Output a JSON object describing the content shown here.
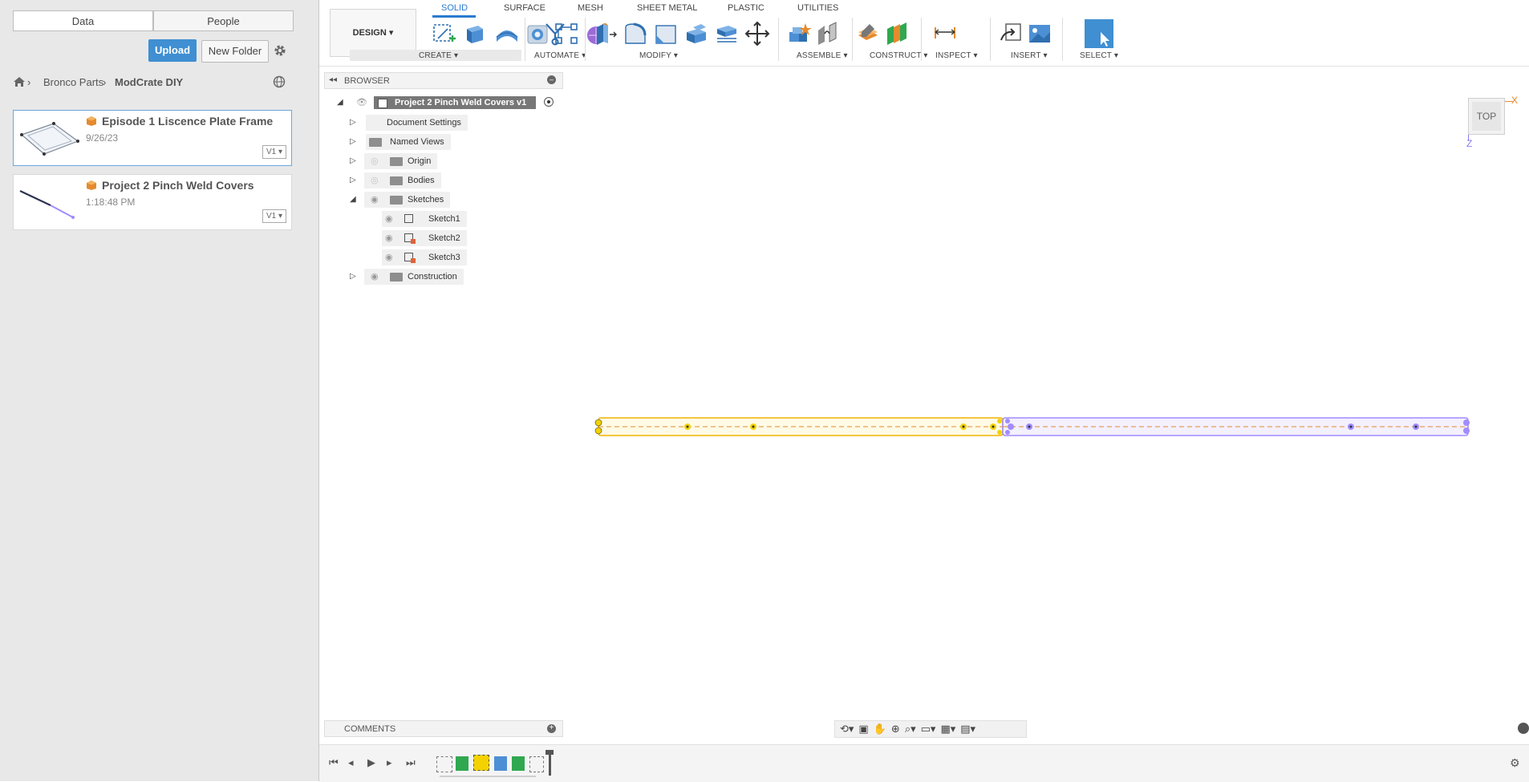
{
  "data_panel": {
    "tabs": [
      "Data",
      "People"
    ],
    "upload_label": "Upload",
    "new_folder_label": "New Folder",
    "breadcrumb": [
      "Bronco Parts",
      "ModCrate DIY"
    ],
    "files": [
      {
        "name": "Episode 1 Liscence Plate Frame",
        "date": "9/26/23",
        "version": "V1"
      },
      {
        "name": "Project 2 Pinch Weld Covers",
        "date": "1:18:48 PM",
        "version": "V1"
      }
    ]
  },
  "toolbar": {
    "workspace": "DESIGN",
    "tabs": [
      "SOLID",
      "SURFACE",
      "MESH",
      "SHEET METAL",
      "PLASTIC",
      "UTILITIES"
    ],
    "groups": [
      "CREATE",
      "AUTOMATE",
      "MODIFY",
      "ASSEMBLE",
      "CONSTRUCT",
      "INSPECT",
      "INSERT",
      "SELECT"
    ]
  },
  "browser": {
    "title": "BROWSER",
    "root": "Project 2 Pinch Weld Covers v1",
    "items": [
      "Document Settings",
      "Named Views",
      "Origin",
      "Bodies",
      "Sketches",
      "Construction"
    ],
    "sketches": [
      "Sketch1",
      "Sketch2",
      "Sketch3"
    ]
  },
  "comments_label": "COMMENTS",
  "viewcube": {
    "face": "TOP",
    "axis_x": "X",
    "axis_z": "Z"
  },
  "colors": {
    "accent": "#3f8fd2",
    "yellow": "#f3d200",
    "purple": "#a18bff"
  }
}
